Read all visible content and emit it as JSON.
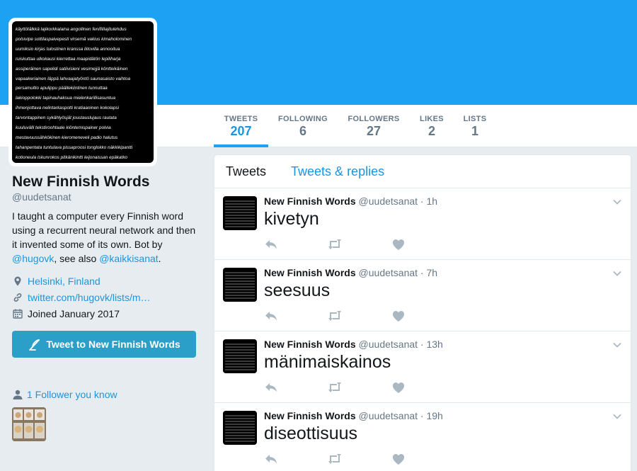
{
  "avatar_words": [
    "käyttötälkkä  lajikorkkalaina  angollinen  fenifililajitulehdus",
    "polsivipe  sottilaspaivepesti  virsemä  vakius  kimaholominen",
    "uumiksio  kirjas  tulostinen  kranssa  liitovilla  annooitua",
    "ruiskuttaa  ulkokausi  kierrettaa  maapidätön  lepiliharja",
    "assiperäinen  sapelidi  satiivisieni  vesimejjä  köntteikäinen",
    "vapaakeriainen  läppä  lahvaajatyöntö  saunasaisto  vaihtoa",
    "persamultio  apulippu  päällekiintinen  tunnuttaa",
    "lakioppolokki  tapinauhaksua  mielenkarillisasuntua",
    "ihmenjottava  nelintarkaspotti  kratiaaninen  kokolapsi",
    "tarvontappinen  sykählyösjät  joustauslujaus  rautata",
    "kuuluvälli  tekstiroohtaale  kiöntemispainer  polvia",
    "mestavuussähkökinen  kieromeneveli  padio  halutus",
    "tahanpentata  tuntulava  pissaproosi  tonglokko  näkkikipantti",
    "kotioneula  Iskunrokos  pitkänikintti  leijonaissan  epäkatko"
  ],
  "stats": [
    {
      "label": "TWEETS",
      "value": "207"
    },
    {
      "label": "FOLLOWING",
      "value": "6"
    },
    {
      "label": "FOLLOWERS",
      "value": "27"
    },
    {
      "label": "LIKES",
      "value": "2"
    },
    {
      "label": "LISTS",
      "value": "1"
    }
  ],
  "profile": {
    "name": "New Finnish Words",
    "handle": "@uudetsanat",
    "bio_1": "I taught a computer every Finnish word using a recurrent neural network and then it invented some of its own. Bot by ",
    "bio_mention_1": "@hugovk",
    "bio_2": ", see also ",
    "bio_mention_2": "@kaikkisanat",
    "bio_3": ".",
    "location": "Helsinki, Finland",
    "website": "twitter.com/hugovk/lists/m…",
    "joined": "Joined January 2017",
    "tweet_button": "Tweet to New Finnish Words",
    "followers_you_know": "1 Follower you know"
  },
  "tabs": {
    "tweets": "Tweets",
    "replies": "Tweets & replies"
  },
  "tweets": [
    {
      "name": "New Finnish Words",
      "handle": "@uudetsanat",
      "time": "1h",
      "text": "kivetyn"
    },
    {
      "name": "New Finnish Words",
      "handle": "@uudetsanat",
      "time": "7h",
      "text": "seesuus"
    },
    {
      "name": "New Finnish Words",
      "handle": "@uudetsanat",
      "time": "13h",
      "text": "mänimaiskainos"
    },
    {
      "name": "New Finnish Words",
      "handle": "@uudetsanat",
      "time": "19h",
      "text": "diseottisuus"
    }
  ],
  "colors": {
    "banner": "#1da1f2",
    "link": "#1b95e0",
    "tweet_button": "#2b9fc8",
    "active_underline": "#1da1f2"
  },
  "icons": {
    "location": "location-pin-icon",
    "website": "link-icon",
    "joined": "calendar-icon",
    "compose": "compose-quill-icon",
    "followers": "person-icon",
    "reply": "reply-icon",
    "retweet": "retweet-icon",
    "like": "heart-icon",
    "menu": "chevron-down-icon"
  }
}
